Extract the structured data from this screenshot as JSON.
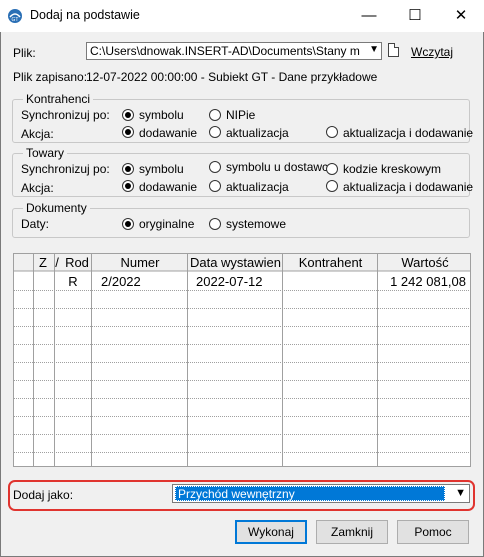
{
  "window": {
    "title": "Dodaj na podstawie",
    "icon": "app-icon",
    "minimize": "—",
    "maximize": "☐",
    "close": "✕"
  },
  "file": {
    "label": "Plik:",
    "path": "C:\\Users\\dnowak.INSERT-AD\\Documents\\Stany magazyn",
    "load_link": "Wczytaj"
  },
  "saved": {
    "label": "Plik zapisano:",
    "value": "12-07-2022 00:00:00 - Subiekt GT - Dane przykładowe"
  },
  "kontrahenci": {
    "title": "Kontrahenci",
    "sync_label": "Synchronizuj po:",
    "sync_options": [
      "symbolu",
      "NIPie"
    ],
    "sync_selected": "symbolu",
    "action_label": "Akcja:",
    "action_options": [
      "dodawanie",
      "aktualizacja",
      "aktualizacja i dodawanie"
    ],
    "action_selected": "dodawanie"
  },
  "towary": {
    "title": "Towary",
    "sync_label": "Synchronizuj po:",
    "sync_options": [
      "symbolu",
      "symbolu u dostawcy",
      "kodzie kreskowym"
    ],
    "sync_selected": "symbolu",
    "action_label": "Akcja:",
    "action_options": [
      "dodawanie",
      "aktualizacja",
      "aktualizacja i dodawanie"
    ],
    "action_selected": "dodawanie"
  },
  "dokumenty": {
    "title": "Dokumenty",
    "dates_label": "Daty:",
    "dates_options": [
      "oryginalne",
      "systemowe"
    ],
    "dates_selected": "oryginalne"
  },
  "table": {
    "columns": [
      "Z",
      "/",
      "Rod",
      "Numer",
      "Data wystawien",
      "Kontrahent",
      "Wartość"
    ],
    "rows": [
      [
        "",
        "",
        "R",
        "2/2022",
        "2022-07-12",
        "",
        "1 242 081,08"
      ]
    ]
  },
  "dodaj_jako": {
    "label": "Dodaj jako:",
    "selected": "Przychód wewnętrzny"
  },
  "buttons": {
    "execute": "Wykonaj",
    "close": "Zamknij",
    "help": "Pomoc"
  }
}
